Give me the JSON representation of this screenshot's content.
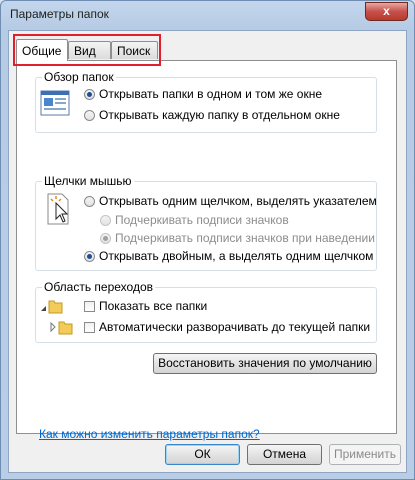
{
  "window": {
    "title": "Параметры папок",
    "close_label": "x"
  },
  "tabs": [
    {
      "label": "Общие",
      "active": true
    },
    {
      "label": "Вид",
      "active": false
    },
    {
      "label": "Поиск",
      "active": false
    }
  ],
  "browse": {
    "title": "Обзор папок",
    "options": [
      {
        "label": "Открывать папки в одном и том же окне",
        "checked": true
      },
      {
        "label": "Открывать каждую папку в отдельном окне",
        "checked": false
      }
    ]
  },
  "clicks": {
    "title": "Щелчки мышью",
    "single": "Открывать одним щелчком, выделять указателем",
    "underline_always": "Подчеркивать подписи значков",
    "underline_hover": "Подчеркивать подписи значков при наведении",
    "double": "Открывать двойным, а выделять одним щелчком"
  },
  "nav": {
    "title": "Область переходов",
    "show_all": "Показать все папки",
    "auto_expand": "Автоматически разворачивать до текущей папки"
  },
  "restore_label": "Восстановить значения по умолчанию",
  "help_link": "Как можно изменить параметры папок?",
  "buttons": {
    "ok": "ОК",
    "cancel": "Отмена",
    "apply": "Применить"
  },
  "colors": {
    "accent": "#1e4e93",
    "highlight": "#e0202a",
    "link": "#0066cc"
  }
}
